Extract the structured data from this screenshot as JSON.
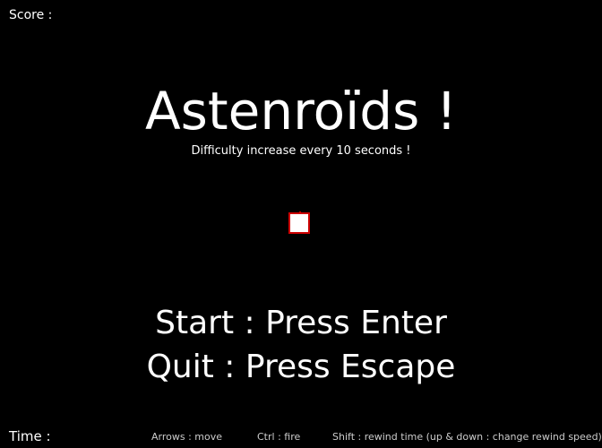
{
  "hud": {
    "score_label": "Score :",
    "time_label": "Time :"
  },
  "title_screen": {
    "title": "Astenroïds !",
    "subtitle": "Difficulty increase every 10 seconds !",
    "start_prompt": "Start : Press Enter",
    "quit_prompt": "Quit : Press Escape"
  },
  "controls": {
    "move": "Arrows : move",
    "fire": "Ctrl : fire",
    "rewind": "Shift : rewind time (up & down : change rewind speed)"
  },
  "colors": {
    "background": "#000000",
    "text": "#ffffff",
    "ship_fill": "#ffffff",
    "ship_outline": "#cc0000"
  }
}
